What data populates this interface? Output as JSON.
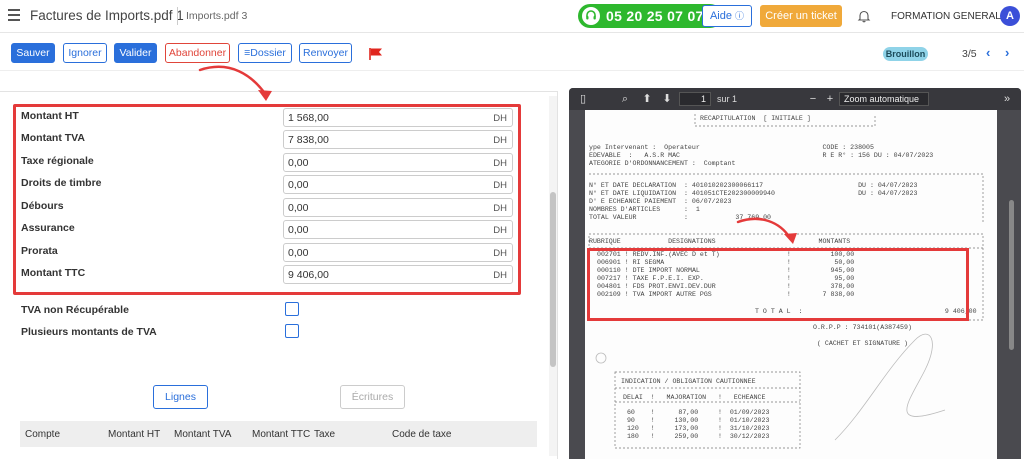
{
  "header": {
    "title": "Factures de Imports.pdf 1",
    "subtitle": "Imports.pdf 3",
    "phone": "05 20 25 07 07",
    "help_label": "Aide",
    "ticket_label": "Créer un ticket",
    "org_name": "FORMATION GENERALE",
    "avatar_letter": "A"
  },
  "toolbar": {
    "save": "Sauver",
    "ignore": "Ignorer",
    "validate": "Valider",
    "abandon": "Abandonner",
    "folder": "Dossier",
    "resend": "Renvoyer",
    "status": "Brouillon",
    "pager": "3/5"
  },
  "form": {
    "rows": [
      {
        "label": "Montant HT",
        "value": "1 568,00",
        "unit": "DH"
      },
      {
        "label": "Montant TVA",
        "value": "7 838,00",
        "unit": "DH"
      },
      {
        "label": "Taxe régionale",
        "value": "0,00",
        "unit": "DH"
      },
      {
        "label": "Droits de timbre",
        "value": "0,00",
        "unit": "DH"
      },
      {
        "label": "Débours",
        "value": "0,00",
        "unit": "DH"
      },
      {
        "label": "Assurance",
        "value": "0,00",
        "unit": "DH"
      },
      {
        "label": "Prorata",
        "value": "0,00",
        "unit": "DH"
      },
      {
        "label": "Montant TTC",
        "value": "9 406,00",
        "unit": "DH"
      }
    ],
    "checkboxes": [
      {
        "label": "TVA non Récupérable"
      },
      {
        "label": "Plusieurs montants de TVA"
      }
    ],
    "lines_tab": "Lignes",
    "entries_tab": "Écritures",
    "table_headers": [
      "Compte",
      "Montant HT",
      "Montant TVA",
      "Montant TTC",
      "Taxe",
      "Code de taxe"
    ]
  },
  "pdf": {
    "page_current": "1",
    "page_of": "sur 1",
    "zoom": "Zoom automatique",
    "lines": {
      "recap": "RECAPITULATION  [ INITIALE ]",
      "l1": "ype Intervenant :  Operateur                               CODE : 238005",
      "l2": "EDEVABLE  :   A.S.R MAC                                    R E R° : 156 DU : 04/07/2023",
      "l3": "ATEGORIE D'ORDONNANCEMENT :  Comptant",
      "l4": "N° ET DATE DECLARATION  : 401010202300066117                        DU : 04/07/2023",
      "l5": "N° ET DATE LIQUIDATION  : 401051CTE202300009940                     DU : 04/07/2023",
      "l6": "D' E ECHEANCE PAIEMENT  : 06/07/2023",
      "l7": "NOMBRES D'ARTICLES      :  1",
      "l8": "TOTAL VALEUR            :            37 769,00",
      "th": "RUBRIQUE            DESIGNATIONS                          MONTANTS",
      "r1": "002701 ! REDV.INF.(AVEC D et T)                 !          100,00",
      "r2": "006901 ! RI SEGMA                               !           50,00",
      "r3": "000110 ! DTE IMPORT NORMAL                      !          945,00",
      "r4": "007217 ! TAXE F.P.E.I. EXP.                     !           95,00",
      "r5": "004801 ! FDS PROT.ENVI.DEV.DUR                  !          378,00",
      "r6": "002109 ! TVA IMPORT AUTRE PGS                   !        7 838,00",
      "total": "T O T A L  :                                    9 406,00",
      "orp": "O.R.P.P : 734101(A387459)",
      "cachet": "( CACHET ET SIGNATURE )",
      "indic": "INDICATION / OBLIGATION CAUTIONNEE",
      "ih": "DELAI  !   MAJORATION   !   ECHEANCE",
      "i1": " 60    !      87,00     !  01/09/2023",
      "i2": " 90    !     130,00     !  01/10/2023",
      "i3": " 120   !     173,00     !  31/10/2023",
      "i4": " 180   !     259,00     !  30/12/2023"
    }
  }
}
